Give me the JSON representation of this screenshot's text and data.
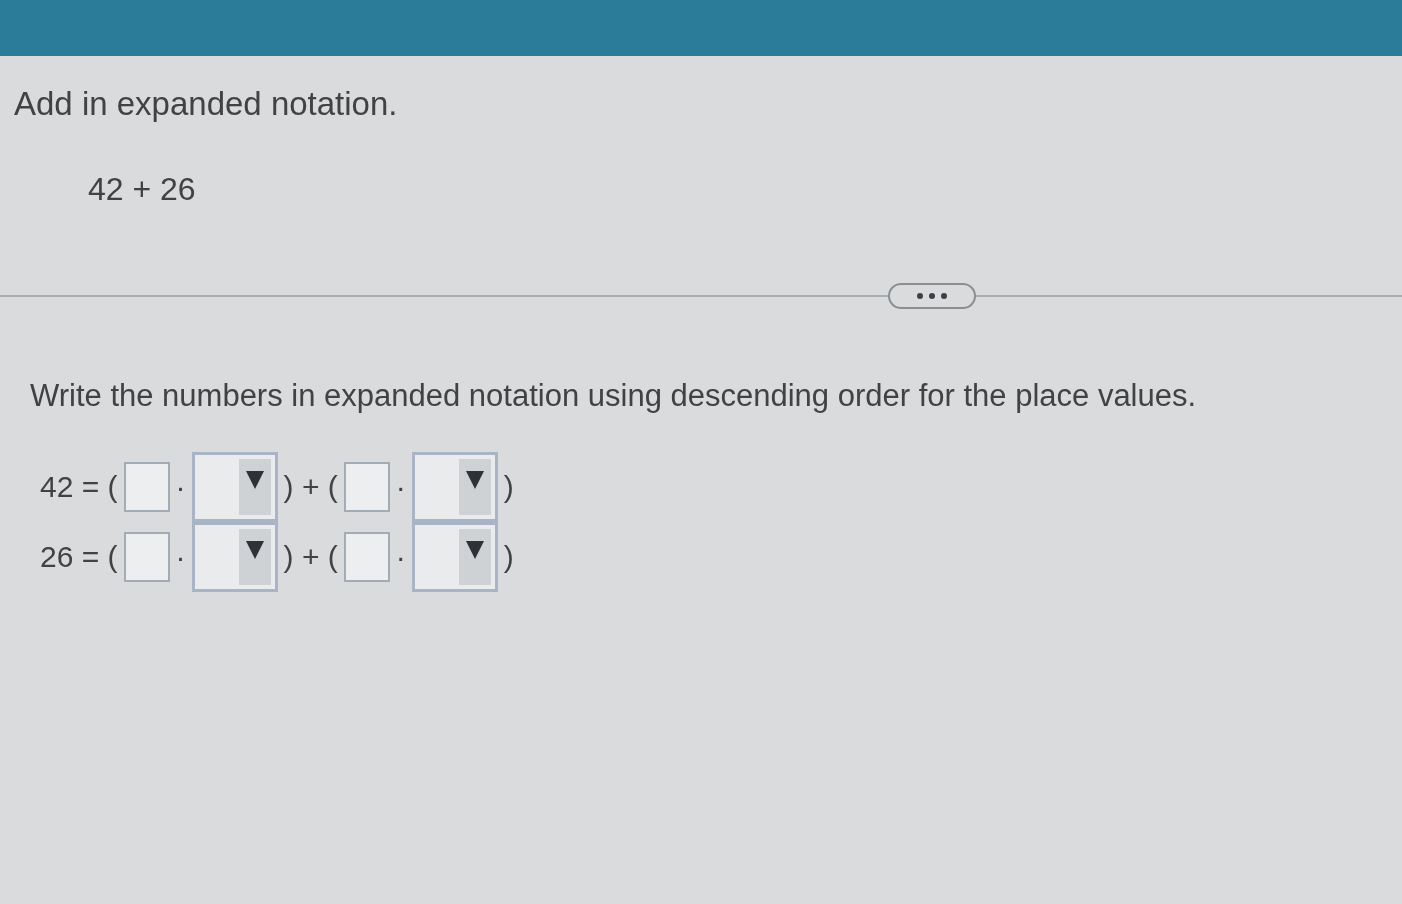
{
  "question": {
    "instruction": "Add in expanded notation.",
    "expression": "42 + 26"
  },
  "answer": {
    "instruction": "Write the numbers in expanded notation using descending order for the place values.",
    "rows": [
      {
        "parts": [
          {
            "kind": "text",
            "text": "42 = ("
          },
          {
            "kind": "input"
          },
          {
            "kind": "text",
            "text": "·"
          },
          {
            "kind": "dropdown"
          },
          {
            "kind": "text",
            "text": ") + ("
          },
          {
            "kind": "input"
          },
          {
            "kind": "text",
            "text": "·"
          },
          {
            "kind": "dropdown"
          },
          {
            "kind": "text",
            "text": ")"
          }
        ]
      },
      {
        "parts": [
          {
            "kind": "text",
            "text": "26 = ("
          },
          {
            "kind": "input"
          },
          {
            "kind": "text",
            "text": "·"
          },
          {
            "kind": "dropdown"
          },
          {
            "kind": "text",
            "text": ") + ("
          },
          {
            "kind": "input"
          },
          {
            "kind": "text",
            "text": "·"
          },
          {
            "kind": "dropdown"
          },
          {
            "kind": "text",
            "text": ")"
          }
        ]
      }
    ]
  }
}
